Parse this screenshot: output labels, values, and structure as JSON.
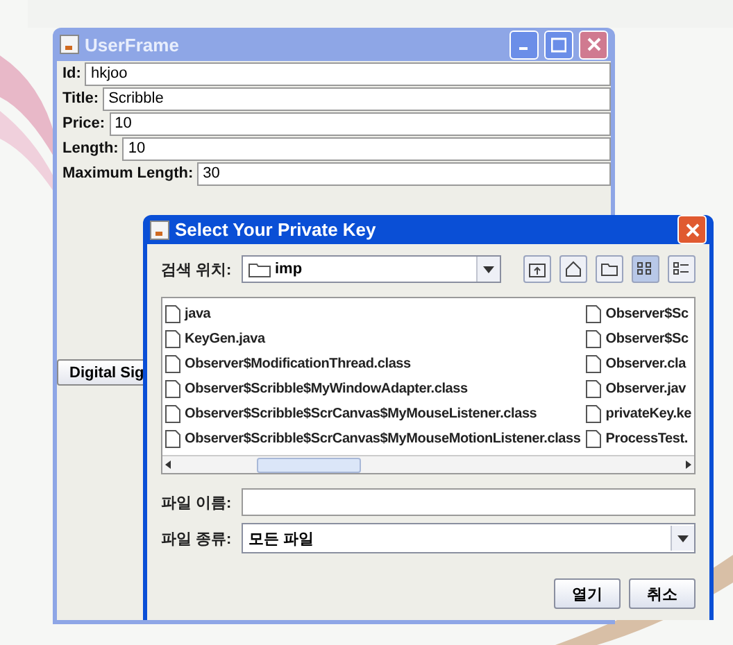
{
  "user_frame": {
    "title": "UserFrame",
    "fields": [
      {
        "label": "Id:",
        "value": "hkjoo"
      },
      {
        "label": "Title:",
        "value": "Scribble"
      },
      {
        "label": "Price:",
        "value": "10"
      },
      {
        "label": "Length:",
        "value": "10"
      },
      {
        "label": "Maximum Length:",
        "value": "30"
      }
    ],
    "button": "Digital Sig"
  },
  "dialog": {
    "title": "Select Your Private Key",
    "look_in_label": "검색 위치:",
    "look_in_value": "imp",
    "view_buttons": [
      {
        "kind": "list",
        "selected": true
      },
      {
        "kind": "details",
        "selected": false
      }
    ],
    "files": [
      [
        "java",
        "KeyGen.java",
        "Observer$ModificationThread.class",
        "Observer$Scribble$MyWindowAdapter.class",
        "Observer$Scribble$ScrCanvas$MyMouseListener.class",
        "Observer$Scribble$ScrCanvas$MyMouseMotionListener.class"
      ],
      [
        "Observer$Sc",
        "Observer$Sc",
        "Observer.cla",
        "Observer.jav",
        "privateKey.ke",
        "ProcessTest."
      ]
    ],
    "file_name_label": "파일 이름:",
    "file_type_label": "파일 종류:",
    "file_type_value": "모든 파일",
    "buttons": [
      "열기",
      "취소"
    ]
  }
}
